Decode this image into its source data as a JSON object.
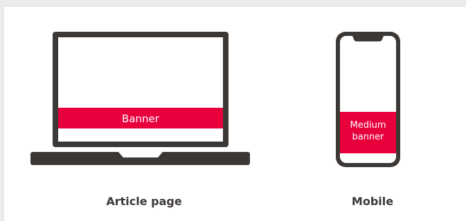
{
  "colors": {
    "device_frame": "#3c3836",
    "banner": "#e8003d",
    "background": "#ffffff",
    "page_background": "#ececec",
    "caption": "#3c3836",
    "banner_text": "#ffffff"
  },
  "laptop": {
    "banner_label": "Banner",
    "caption": "Article page"
  },
  "mobile": {
    "banner_line1": "Medium",
    "banner_line2": "banner",
    "caption": "Mobile"
  }
}
